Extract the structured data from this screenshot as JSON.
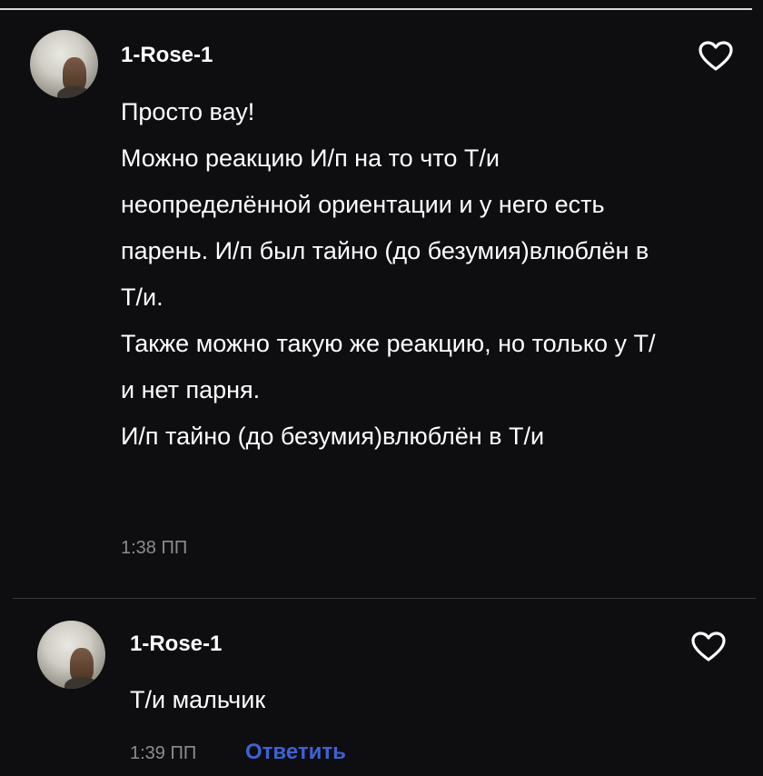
{
  "comments": [
    {
      "username": "1-Rose-1",
      "text": "Просто вау!\nМожно реакцию И/п на то что Т/и неопределённой ориентации и у него есть парень. И/п был тайно (до безумия)влюблён в Т/и.\nТакже можно такую же реакцию, но только у Т/и нет парня.\nИ/п тайно (до безумия)влюблён в Т/и",
      "time": "1:38 ПП",
      "icons": {
        "like": "heart-outline-icon",
        "avatar": "user-avatar"
      }
    },
    {
      "username": "1-Rose-1",
      "text": "Т/и мальчик",
      "time": "1:39 ПП",
      "reply_label": "Ответить",
      "icons": {
        "like": "heart-outline-icon",
        "avatar": "user-avatar"
      }
    }
  ],
  "colors": {
    "background": "#0e0d10",
    "text": "#ffffff",
    "muted": "#8e8c93",
    "link": "#3d62d6"
  }
}
